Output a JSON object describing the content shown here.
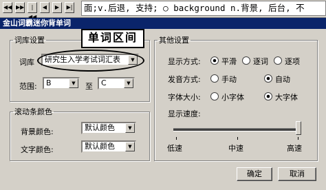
{
  "toolbar": {
    "buttons": [
      "◀◀",
      "▶▶",
      "|◀◀",
      "◀",
      "▶",
      "▶|"
    ],
    "ticker_text": "面;v.后退, 支持; ○ background n.背景, 后台, 不"
  },
  "window": {
    "title": "金山词霸迷你背单词"
  },
  "annotation": {
    "label": "单词区间"
  },
  "vocab_settings": {
    "legend": "词库设置",
    "library_label": "词库",
    "library_value": "研究生入学考试词汇表",
    "range_label": "范围:",
    "range_from": "B",
    "range_to_label": "至",
    "range_to": "C"
  },
  "scroll_colors": {
    "legend": "滚动条颜色",
    "bg_label": "背景颜色:",
    "bg_value": "默认颜色",
    "text_label": "文字颜色:",
    "text_value": "默认颜色"
  },
  "other_settings": {
    "legend": "其他设置",
    "display_mode_label": "显示方式:",
    "display_modes": [
      {
        "label": "平滑",
        "selected": true
      },
      {
        "label": "逐词",
        "selected": false
      },
      {
        "label": "逐项",
        "selected": false
      }
    ],
    "voice_mode_label": "发音方式:",
    "voice_modes": [
      {
        "label": "手动",
        "selected": false
      },
      {
        "label": "自动",
        "selected": true
      }
    ],
    "font_size_label": "字体大小:",
    "font_sizes": [
      {
        "label": "小字体",
        "selected": false
      },
      {
        "label": "大字体",
        "selected": true
      }
    ],
    "speed_label": "显示速度:",
    "speed_level": 1.0,
    "speed_ticks": [
      "低速",
      "中速",
      "高速"
    ]
  },
  "buttons": {
    "ok": "确定",
    "cancel": "取消"
  }
}
